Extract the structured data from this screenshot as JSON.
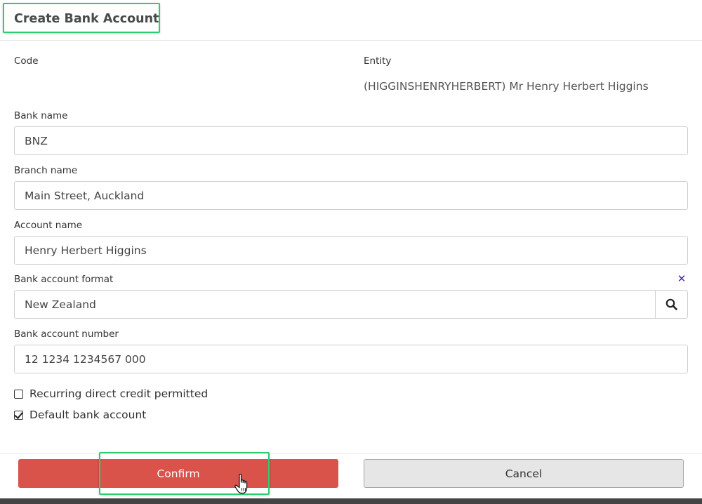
{
  "dialog": {
    "title": "Create Bank Account"
  },
  "form": {
    "code_label": "Code",
    "entity_label": "Entity",
    "entity_value": "(HIGGINSHENRYHERBERT) Mr Henry Herbert Higgins",
    "bank_name_label": "Bank name",
    "bank_name_value": "BNZ",
    "branch_name_label": "Branch name",
    "branch_name_value": "Main Street, Auckland",
    "account_name_label": "Account name",
    "account_name_value": "Henry Herbert Higgins",
    "format_label": "Bank account format",
    "format_value": "New Zealand",
    "format_clear_icon": "close-icon",
    "format_search_icon": "search-icon",
    "account_number_label": "Bank account number",
    "account_number_value": "12 1234 1234567 000",
    "checkboxes": [
      {
        "label": "Recurring direct credit permitted",
        "checked": false
      },
      {
        "label": "Default bank account",
        "checked": true
      }
    ]
  },
  "footer": {
    "confirm_label": "Confirm",
    "cancel_label": "Cancel"
  },
  "colors": {
    "confirm_bg": "#d9534a",
    "cancel_bg": "#e6e6e6",
    "highlight_border": "#2ecc71",
    "clear_icon": "#4a2a9a"
  }
}
